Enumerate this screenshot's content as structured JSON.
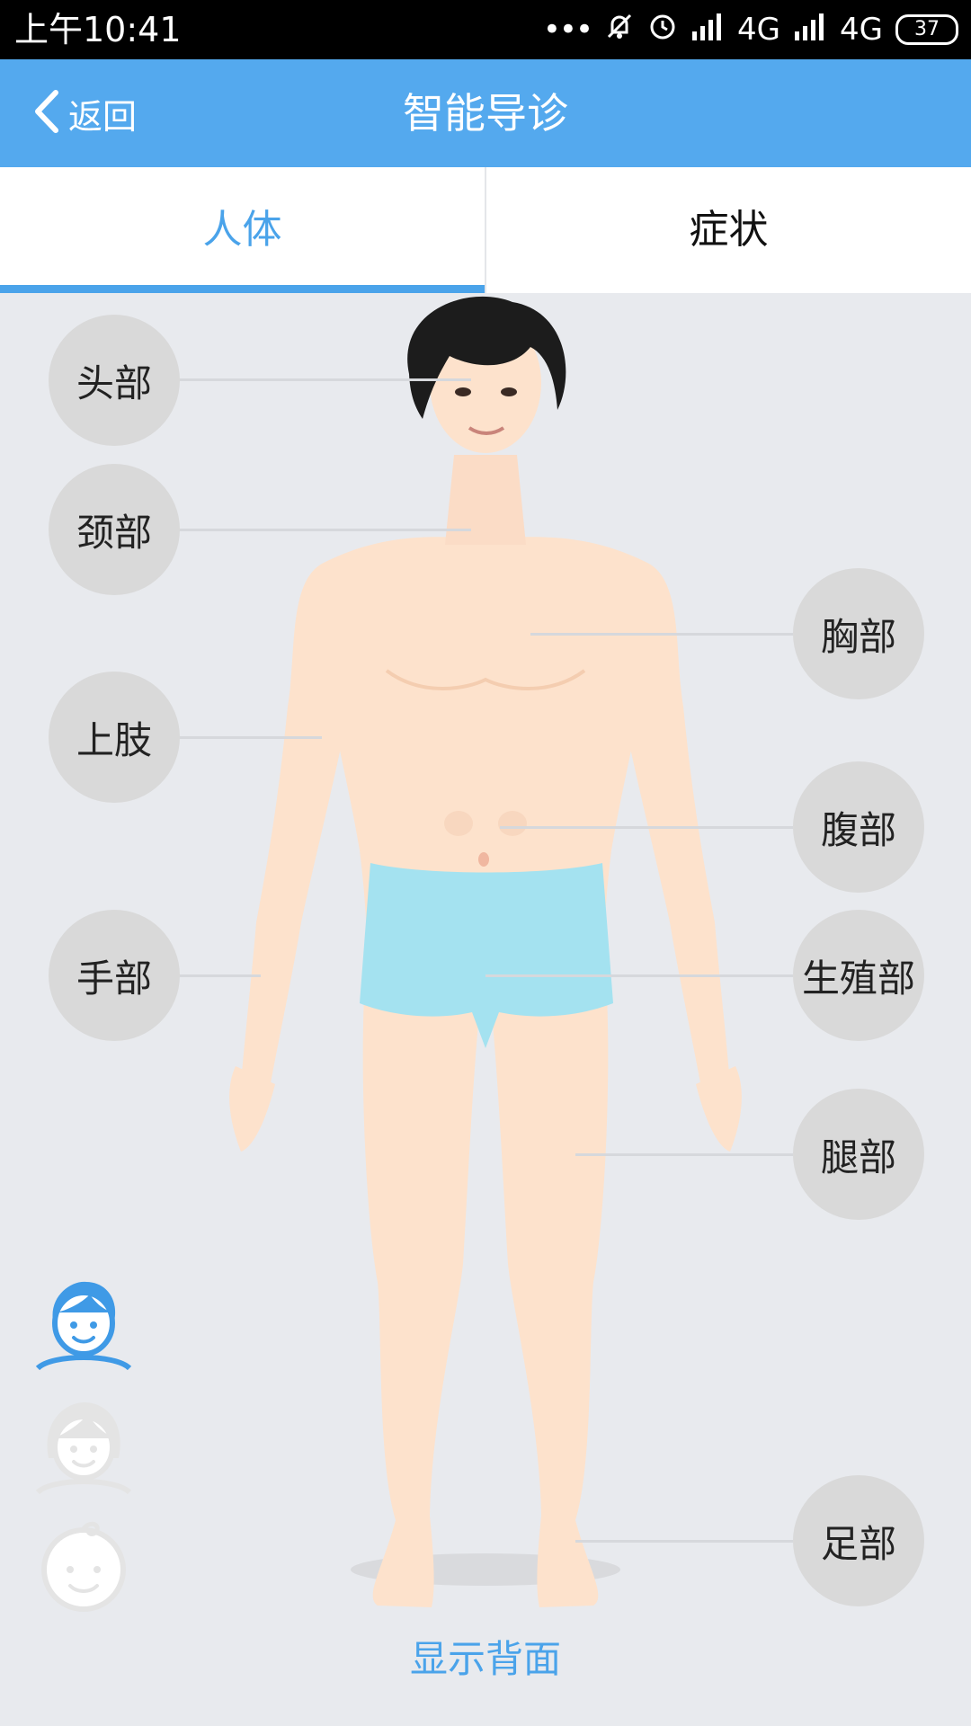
{
  "status_bar": {
    "time": "上午10:41",
    "network1": "4G",
    "network2": "4G",
    "battery": "37"
  },
  "nav": {
    "back_label": "返回",
    "title": "智能导诊"
  },
  "tabs": {
    "body": "人体",
    "symptoms": "症状",
    "active": "body"
  },
  "body_parts": {
    "head": "头部",
    "neck": "颈部",
    "upper_limb": "上肢",
    "hand": "手部",
    "chest": "胸部",
    "abdomen": "腹部",
    "genital": "生殖部",
    "leg": "腿部",
    "foot": "足部"
  },
  "footer": {
    "show_back": "显示背面"
  },
  "colors": {
    "accent": "#54a9ee",
    "tab_active": "#4aa3ea",
    "bubble": "#d9d9d9",
    "background": "#e8eaee"
  },
  "icons": {
    "back": "chevron-left-icon",
    "avatar_male": "male-avatar-icon",
    "avatar_female": "female-avatar-icon",
    "avatar_child": "child-avatar-icon"
  }
}
